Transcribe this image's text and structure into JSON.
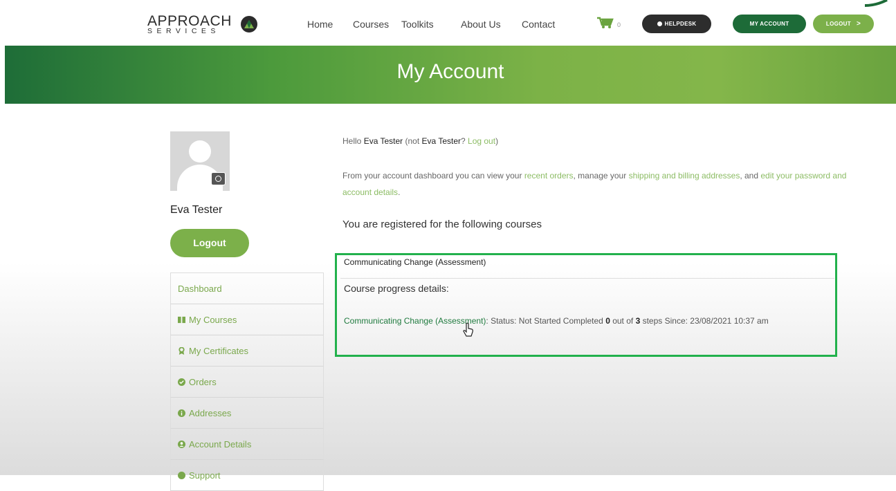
{
  "header": {
    "logo_word": "APPROACH",
    "logo_sub": "SERVICES",
    "nav": [
      "Home",
      "Courses",
      "Toolkits",
      "About Us",
      "Contact"
    ],
    "cart_count": "0",
    "helpdesk_label": "HELPDESK",
    "my_account_label": "MY ACCOUNT",
    "logout_label": "LOGOUT",
    "colors": {
      "dark_green": "#1d6b38",
      "light_green": "#7cb04a",
      "dark": "#2d2d2d"
    }
  },
  "banner": {
    "title": "My Account"
  },
  "profile": {
    "name": "Eva Tester",
    "logout_label": "Logout"
  },
  "menu": {
    "items": [
      {
        "label": "Dashboard",
        "icon": "none"
      },
      {
        "label": "My Courses",
        "icon": "book-icon"
      },
      {
        "label": "My Certificates",
        "icon": "award-icon"
      },
      {
        "label": "Orders",
        "icon": "check-circle-icon"
      },
      {
        "label": "Addresses",
        "icon": "info-circle-icon"
      },
      {
        "label": "Account Details",
        "icon": "user-circle-icon"
      },
      {
        "label": "Support",
        "icon": "question-circle-icon"
      }
    ]
  },
  "main": {
    "hello_prefix": "Hello ",
    "user": "Eva Tester",
    "not_prefix": " (not ",
    "not_user": "Eva Tester",
    "question": "? ",
    "logout_link": "Log out",
    "close_paren": ")",
    "dash_1": "From your account dashboard you can view your ",
    "link_orders": "recent orders",
    "dash_2": ", manage your ",
    "link_addresses": "shipping and billing addresses",
    "dash_3": ", and ",
    "link_password": "edit your password and account details",
    "dash_4": ".",
    "registered_text": "You are registered for the following courses"
  },
  "course": {
    "title": "Communicating Change (Assessment)",
    "progress_heading": "Course progress details:",
    "link": "Communicating Change (Assessment)",
    "status_text": ": Status: Not Started Completed ",
    "completed": "0",
    "out_of": " out of ",
    "total": "3",
    "since_text": " steps Since: 23/08/2021 10:37 am"
  }
}
